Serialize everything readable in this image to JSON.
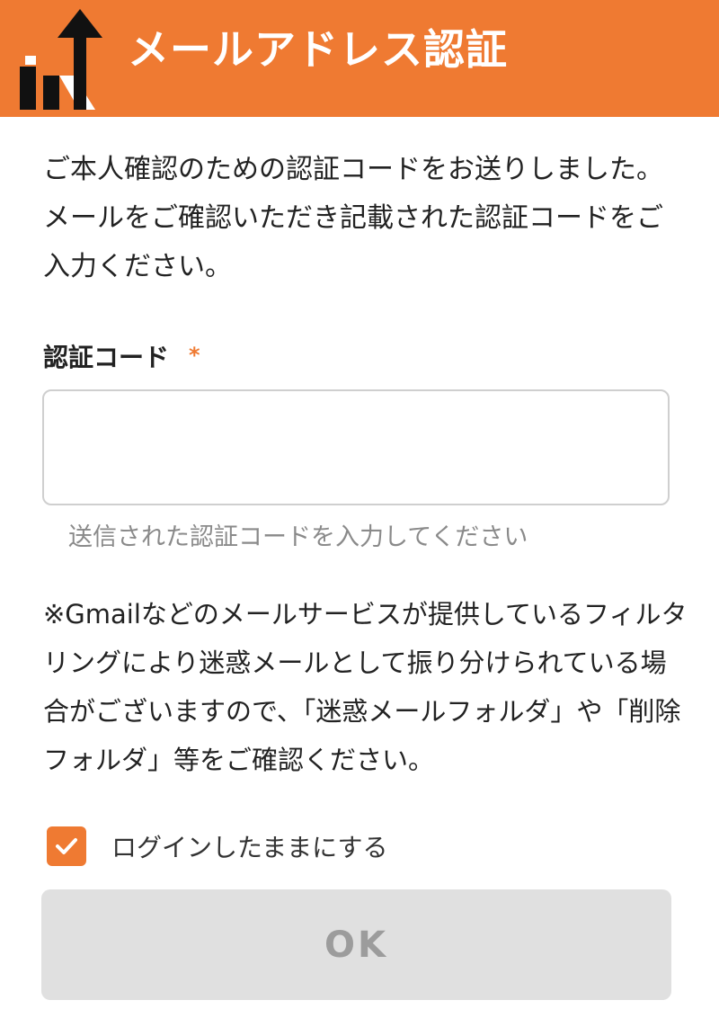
{
  "header": {
    "title": "メールアドレス認証",
    "background_color": "#ef7a32",
    "logo_icon": "rising-arrow-logo-icon"
  },
  "intro": {
    "text": "ご本人確認のための認証コードをお送りしました。メールをご確認いただき記載された認証コードをご入力ください。"
  },
  "code_field": {
    "label": "認証コード",
    "required_mark": "*",
    "value": "",
    "hint": "送信された認証コードを入力してください"
  },
  "notice": {
    "text": "※Gmailなどのメールサービスが提供しているフィルタリングにより迷惑メールとして振り分けられている場合がございますので、「迷惑メールフォルダ」や「削除フォルダ」等をご確認ください。"
  },
  "remember_login": {
    "label": "ログインしたままにする",
    "checked": true,
    "check_icon": "check-icon"
  },
  "submit": {
    "label": "OK",
    "disabled": true
  }
}
